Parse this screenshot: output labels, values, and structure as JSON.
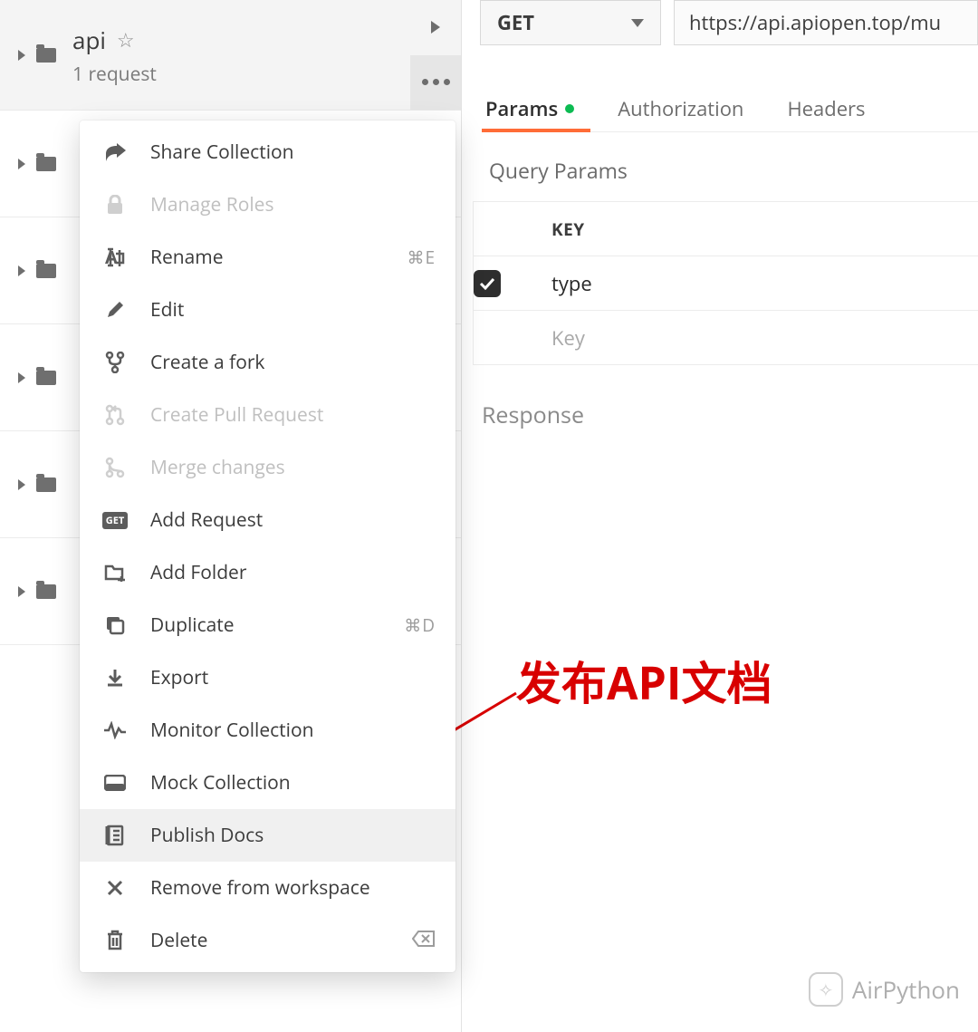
{
  "sidebar": {
    "collection": {
      "name": "api",
      "subtitle": "1 request"
    },
    "rows": 5
  },
  "menu": {
    "share": "Share Collection",
    "manage_roles": "Manage Roles",
    "rename": "Rename",
    "rename_shortcut": "⌘E",
    "edit": "Edit",
    "create_fork": "Create a fork",
    "create_pr": "Create Pull Request",
    "merge": "Merge changes",
    "add_request": "Add Request",
    "add_request_badge": "GET",
    "add_folder": "Add Folder",
    "duplicate": "Duplicate",
    "duplicate_shortcut": "⌘D",
    "export": "Export",
    "monitor": "Monitor Collection",
    "mock": "Mock Collection",
    "publish_docs": "Publish Docs",
    "remove": "Remove from workspace",
    "delete": "Delete"
  },
  "request": {
    "method": "GET",
    "url": "https://api.apiopen.top/mu"
  },
  "tabs": {
    "params": "Params",
    "authorization": "Authorization",
    "headers": "Headers"
  },
  "query": {
    "section_title": "Query Params",
    "key_header": "KEY",
    "row1_key": "type",
    "placeholder_key": "Key"
  },
  "response_label": "Response",
  "annotation": "发布API文档",
  "watermark": "AirPython"
}
